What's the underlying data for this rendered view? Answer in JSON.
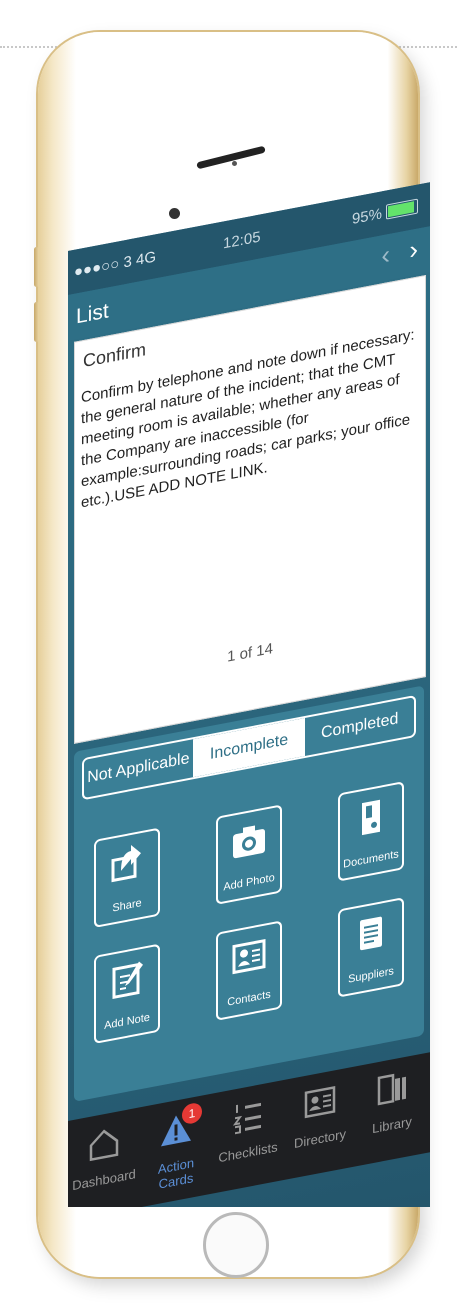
{
  "status": {
    "signal": "●●●○○ 3  4G",
    "time": "12:05",
    "battery": "95%"
  },
  "nav": {
    "title": "List",
    "back_icon": "‹",
    "forward_icon": "›"
  },
  "card": {
    "heading": "Confirm",
    "body": "Confirm by telephone and note down if necessary: the general nature of the incident; that the CMT meeting room is available; whether any areas of the Company are inaccessible (for example:surrounding roads; car parks; your office etc.).USE ADD NOTE LINK.",
    "page_indicator": "1 of 14"
  },
  "segments": {
    "not_applicable": "Not Applicable",
    "incomplete": "Incomplete",
    "completed": "Completed",
    "selected": "incomplete"
  },
  "actions": {
    "share": "Share",
    "add_photo": "Add Photo",
    "documents": "Documents",
    "add_note": "Add Note",
    "contacts": "Contacts",
    "suppliers": "Suppliers"
  },
  "tabbar": {
    "dashboard": "Dashboard",
    "action_cards": "Action Cards",
    "action_cards_badge": "1",
    "checklists": "Checklists",
    "directory": "Directory",
    "library": "Library",
    "active": "action_cards",
    "active_color": "#5b8fd6"
  },
  "colors": {
    "accent": "#2e6f86",
    "badge": "#e53935",
    "battery": "#63e36b"
  }
}
